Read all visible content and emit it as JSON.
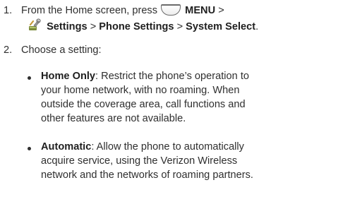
{
  "step1": {
    "number": "1.",
    "text_before_icon": "From the Home screen, press",
    "menu_key_icon": "menu-key-icon",
    "menu_label": "MENU",
    "sep1": ">",
    "settings_icon": "settings-wrench-icon",
    "settings_label": "Settings",
    "sep2": ">",
    "phone_settings_label": "Phone Settings",
    "sep3": ">",
    "system_select_label": "System Select",
    "end": "."
  },
  "step2": {
    "number": "2.",
    "text": "Choose a setting:"
  },
  "options": [
    {
      "term": "Home Only",
      "lines": [
        ": Restrict the phone’s operation to",
        "your home network, with no roaming. When",
        "outside the coverage area, call functions and",
        "other features are not available."
      ]
    },
    {
      "term": "Automatic",
      "lines": [
        ": Allow the phone to automatically",
        "acquire service, using the Verizon Wireless",
        "network and the networks of roaming partners."
      ]
    }
  ]
}
